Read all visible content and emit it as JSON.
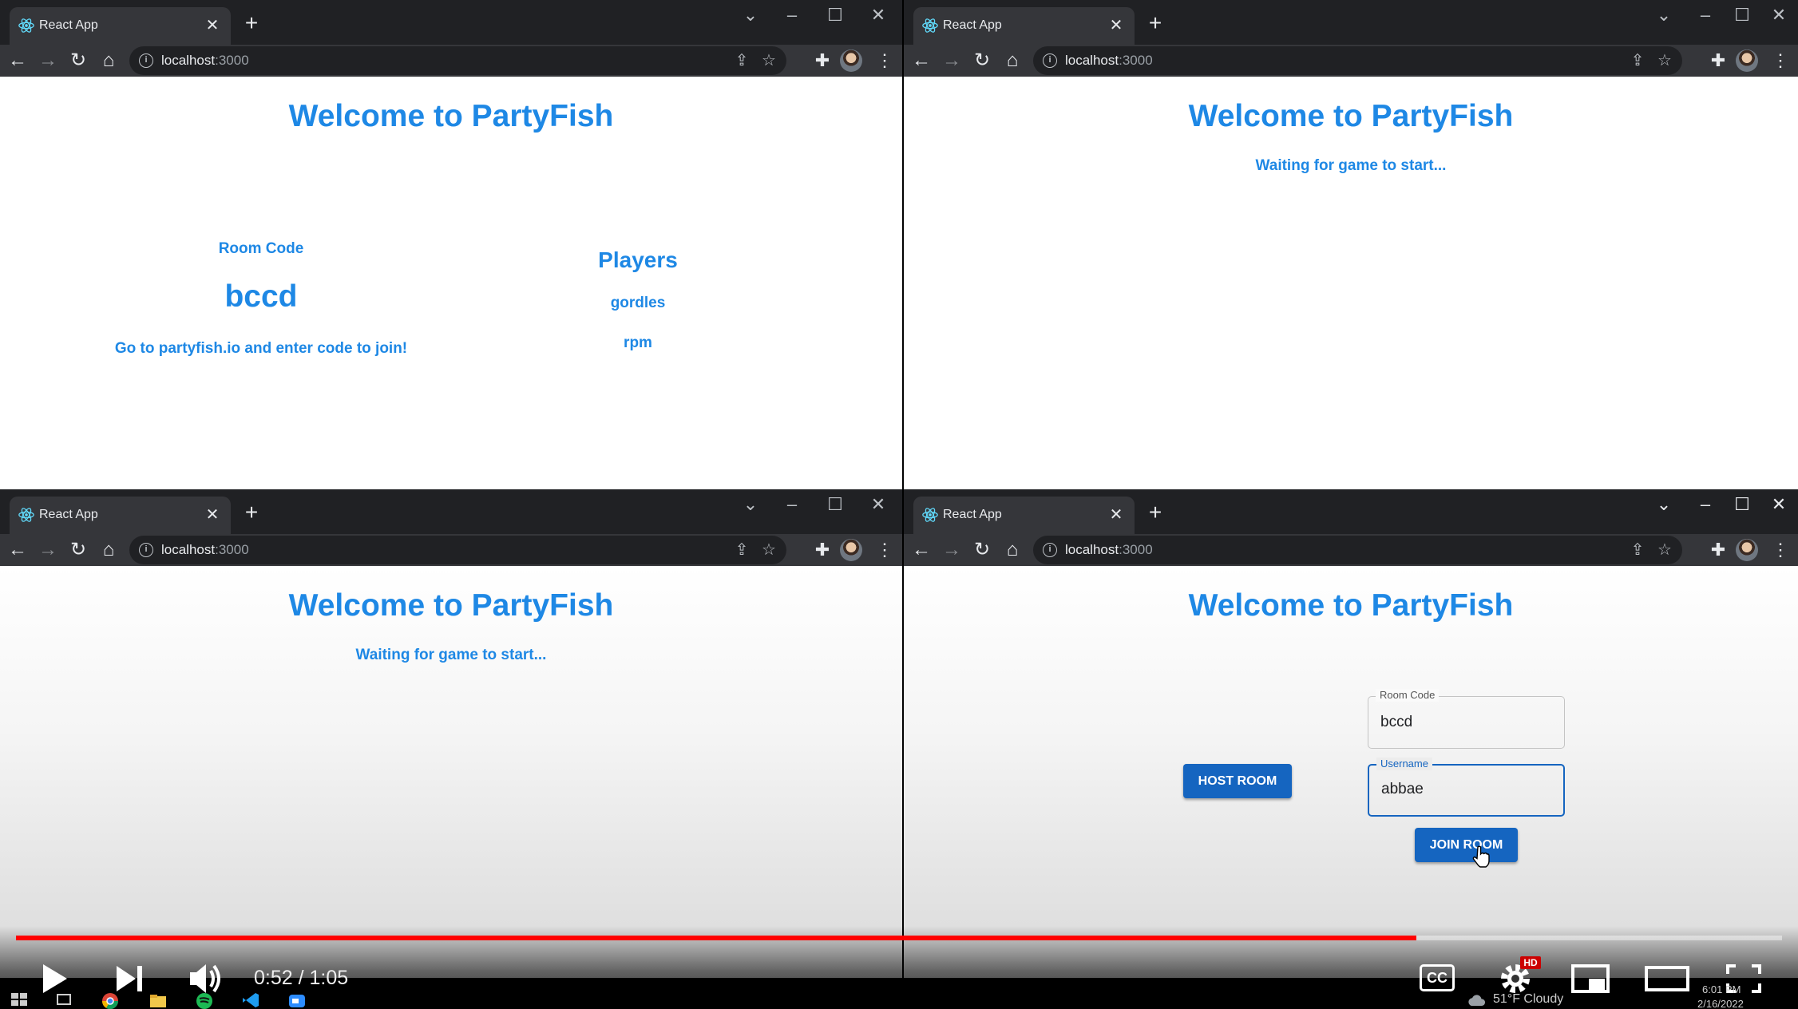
{
  "browser": {
    "tab_title": "React App",
    "tab_close": "✕",
    "new_tab": "+",
    "url_host": "localhost",
    "url_port": ":3000"
  },
  "app": {
    "heading": "Welcome to PartyFish",
    "waiting_text": "Waiting for game to start..."
  },
  "host_view": {
    "room_code_label": "Room Code",
    "room_code": "bccd",
    "join_note": "Go to partyfish.io and enter code to join!",
    "players_title": "Players",
    "players": [
      "gordles",
      "rpm"
    ]
  },
  "join_form": {
    "host_button": "HOST ROOM",
    "room_code_label": "Room Code",
    "room_code_value": "bccd",
    "username_label": "Username",
    "username_value": "abbae",
    "join_button": "JOIN ROOM"
  },
  "video_player": {
    "time_display": "0:52 / 1:05",
    "progress": 0.793,
    "cc_label": "CC",
    "hd_badge": "HD"
  },
  "taskbar": {
    "weather": "51°F  Cloudy",
    "clock_time": "6:01 PM",
    "clock_date": "2/16/2022"
  },
  "colors": {
    "accent": "#1e88e5",
    "button": "#1565c0",
    "progress": "#ff0000"
  }
}
